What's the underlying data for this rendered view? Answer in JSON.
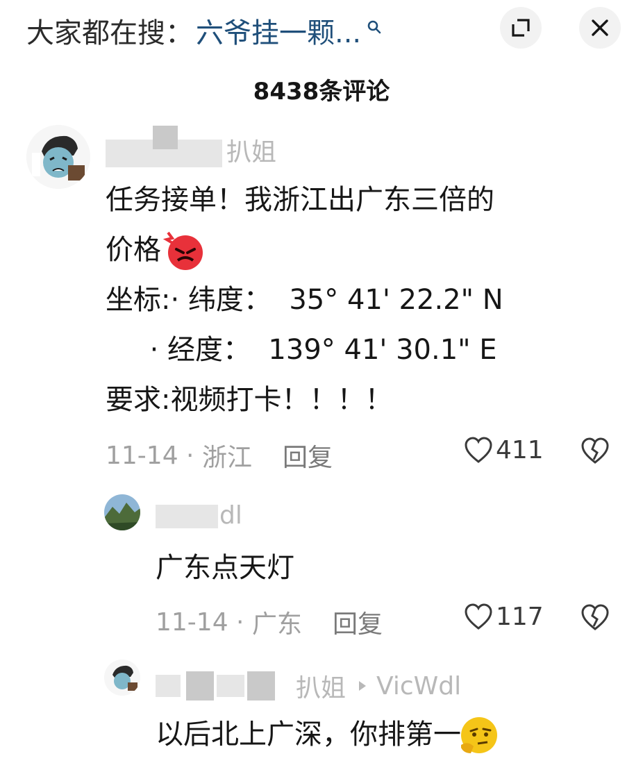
{
  "header": {
    "search_prefix": "大家都在搜：",
    "search_query": "六爷挂一颗...",
    "comment_count": "8438条评论"
  },
  "comments": [
    {
      "username_fragment": "扒姐",
      "lines": [
        "任务接单！我浙江出广东三倍的",
        "价格",
        "坐标:· 纬度：  35° 41' 22.2\" N",
        "     · 经度：  139° 41' 30.1\" E",
        "要求:视频打卡！！！！"
      ],
      "date": "11-14",
      "location": "浙江",
      "reply_label": "回复",
      "likes": "411"
    }
  ],
  "replies": [
    {
      "username_fragment": "dl",
      "text": "广东点天灯",
      "date": "11-14",
      "location": "广东",
      "reply_label": "回复",
      "likes": "117"
    },
    {
      "username_fragment": "扒姐",
      "reply_to": "VicWdl",
      "text": "以后北上广深，你排第一"
    }
  ],
  "colors": {
    "accent_link": "#1f4f7a",
    "meta_gray": "#a0a0a0",
    "emoji_red": "#e8313a",
    "emoji_yellow": "#f5c518"
  }
}
